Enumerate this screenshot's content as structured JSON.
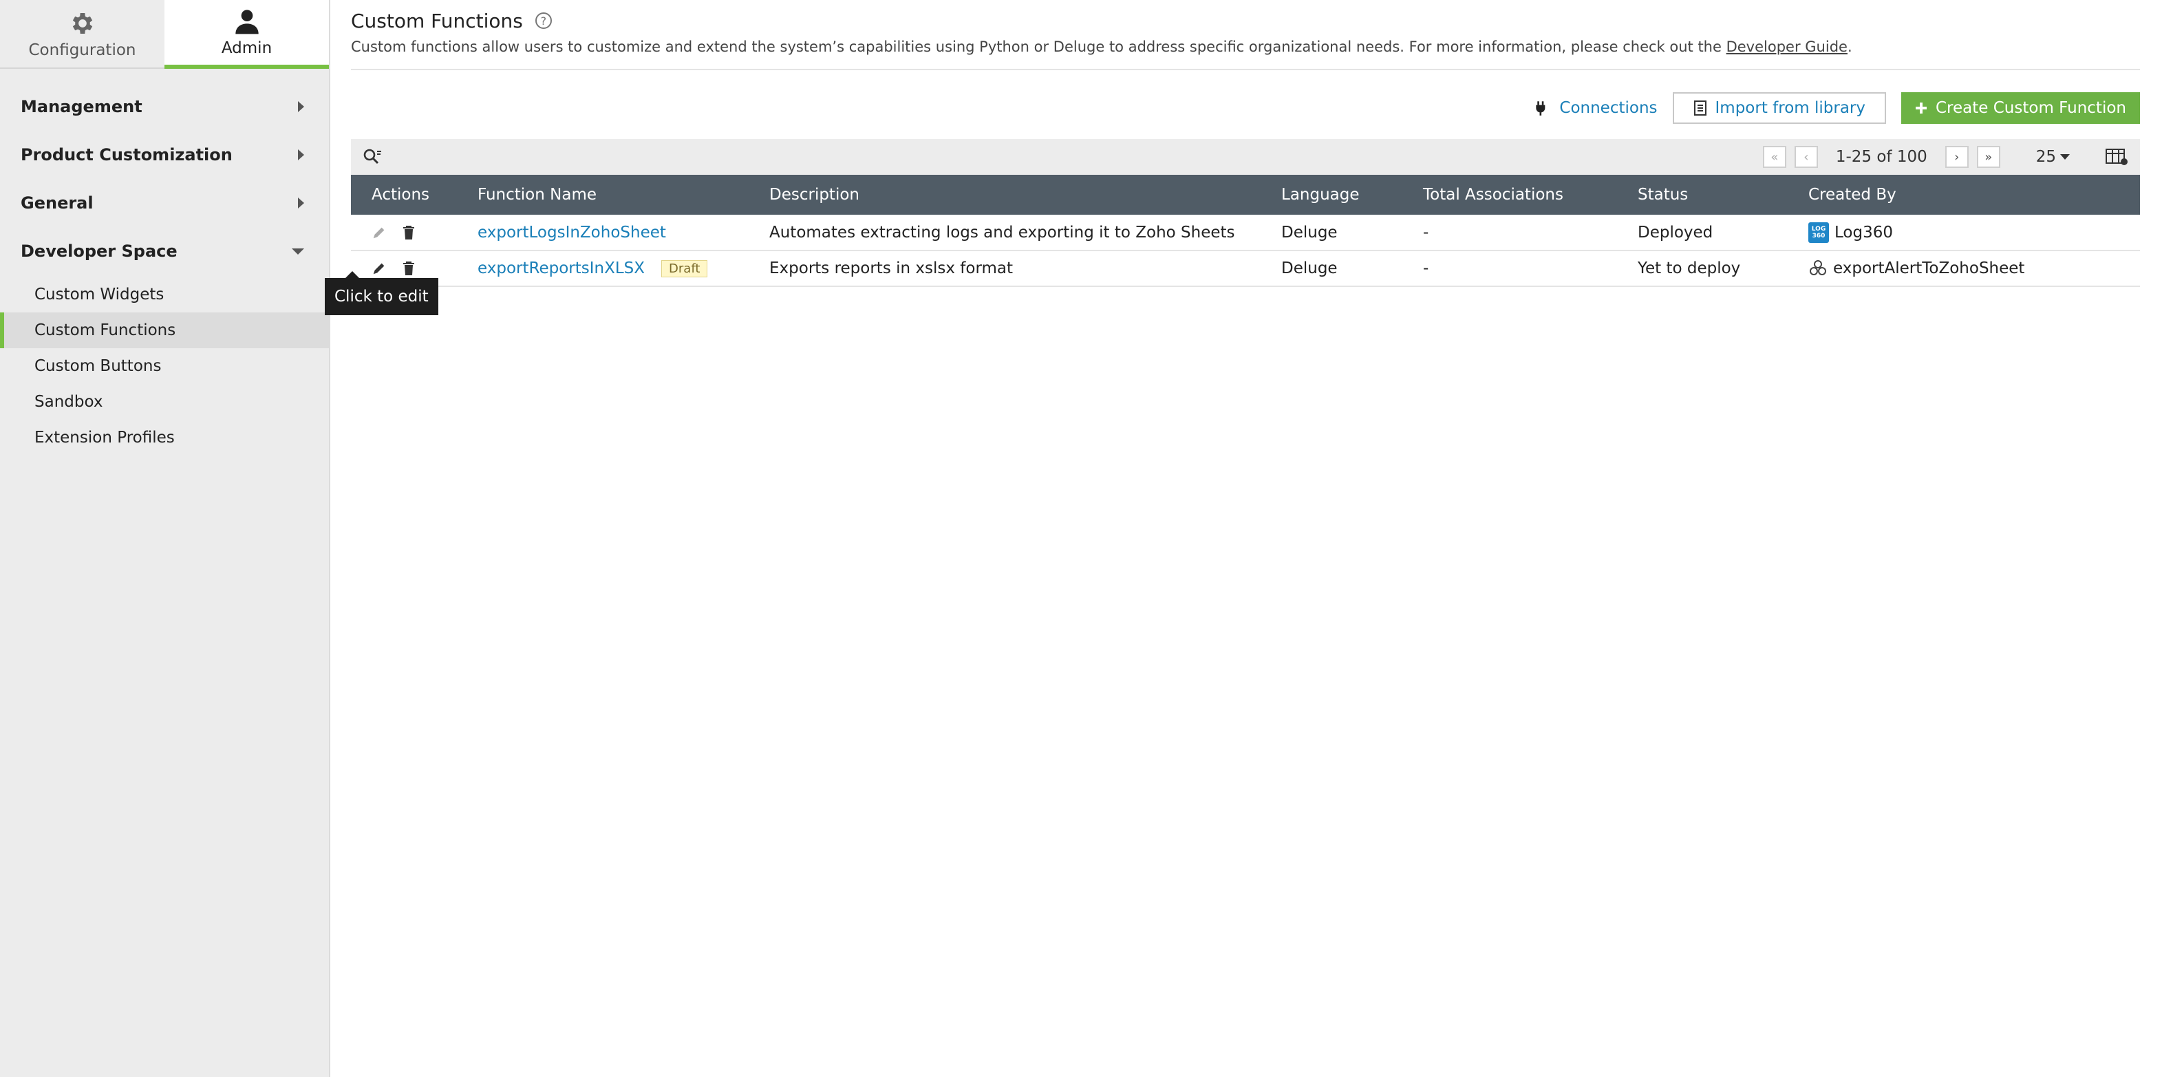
{
  "top_tabs": [
    {
      "label": "Configuration",
      "icon": "gear-icon"
    },
    {
      "label": "Admin",
      "icon": "user-icon",
      "active": true
    }
  ],
  "sidebar": {
    "sections": [
      {
        "label": "Management",
        "expanded": false
      },
      {
        "label": "Product Customization",
        "expanded": false
      },
      {
        "label": "General",
        "expanded": false
      },
      {
        "label": "Developer Space",
        "expanded": true
      }
    ],
    "developer_items": [
      "Custom Widgets",
      "Custom Functions",
      "Custom Buttons",
      "Sandbox",
      "Extension Profiles"
    ],
    "active_item": "Custom Functions"
  },
  "header": {
    "title": "Custom Functions",
    "help_symbol": "?",
    "description": "Custom functions allow users to customize and extend the system’s capabilities using Python or Deluge to address specific organizational needs. For more information, please check out the ",
    "guide_link": "Developer Guide",
    "description_end": "."
  },
  "actions": {
    "connections": "Connections",
    "import": "Import from library",
    "create": "Create Custom Function"
  },
  "pager": {
    "range": "1-25 of 100",
    "per_page": "25"
  },
  "table": {
    "columns": [
      "Actions",
      "Function Name",
      "Description",
      "Language",
      "Total Associations",
      "Status",
      "Created By"
    ],
    "rows": [
      {
        "name": "exportLogsInZohoSheet",
        "badge": "",
        "description": "Automates extracting logs and exporting it to Zoho Sheets",
        "language": "Deluge",
        "associations": "-",
        "status": "Deployed",
        "created_by": "Log360",
        "creator_icon": "log360-logo"
      },
      {
        "name": "exportReportsInXLSX",
        "badge": "Draft",
        "description": "Exports reports in xslsx format",
        "language": "Deluge",
        "associations": "-",
        "status": "Yet to deploy",
        "created_by": "exportAlertToZohoSheet",
        "creator_icon": "extension-icon"
      }
    ]
  },
  "tooltip": "Click to edit",
  "colors": {
    "accent_green": "#6cb244",
    "link_blue": "#1a7fb8",
    "table_header": "#505c66"
  }
}
